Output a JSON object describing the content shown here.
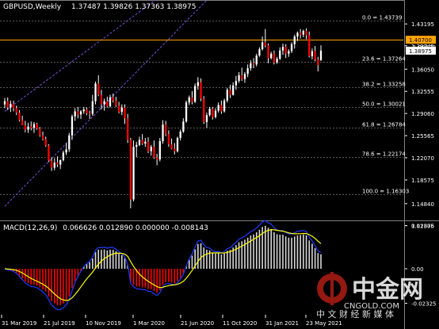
{
  "header": {
    "symbol": "GBPUSD,Weekly",
    "ohlc": "1.37487 1.39826 1.37363 1.38975",
    "macd_title": "MACD(12,26,9)",
    "macd_values": "0.066626 0.012890 0.000000 -0.008143"
  },
  "colors": {
    "bull": "#ffffff",
    "bear": "#ff0000",
    "wick": "#ffffff",
    "grid": "#5a5a5a",
    "axis_text": "#ffffff",
    "resistance": "#ffa500",
    "channel": "#7b4fd6",
    "macd_hist_pos": "#d8d8d8",
    "macd_hist_neg": "#ff0000",
    "macd_line": "#1e3cff",
    "signal_line": "#ffff00",
    "price_box": "#ffffff",
    "resistance_box": "#ffa500"
  },
  "chart_data": [
    {
      "type": "candlestick",
      "title": "GBPUSD,Weekly",
      "timeframe": "Weekly",
      "ylim": [
        1.1319,
        1.4522
      ],
      "y_ticks": [
        1.43195,
        1.39745,
        1.3605,
        1.32555,
        1.2906,
        1.25565,
        1.2207,
        1.18575,
        1.1484,
        1.11375
      ],
      "x_tick_labels": [
        "31 Mar 2019",
        "21 Jul 2019",
        "10 Nov 2019",
        "1 Mar 2020",
        "21 Jun 2020",
        "11 Oct 2020",
        "31 Jan 2021",
        "23 May 2021"
      ],
      "fibonacci": [
        {
          "label": "0.0 = 1.43739",
          "value": 1.43739
        },
        {
          "label": "23.6 = 1.37264",
          "value": 1.37264
        },
        {
          "label": "38.2 = 1.33258",
          "value": 1.33258
        },
        {
          "label": "50.0 = 1.30021",
          "value": 1.30021
        },
        {
          "label": "61.8 = 1.26784",
          "value": 1.26784
        },
        {
          "label": "78.6 = 1.22174",
          "value": 1.22174
        },
        {
          "label": "100.0 = 1.16303",
          "value": 1.16303
        }
      ],
      "resistance": {
        "label": "1.40700",
        "value": 1.407
      },
      "current_price": {
        "label": "1.38975",
        "value": 1.38975
      },
      "hidden_price_label": "1.39620",
      "channel": {
        "upper": [
          [
            0,
            1.294
          ],
          [
            45,
            1.453
          ]
        ],
        "lower": [
          [
            0,
            1.144
          ],
          [
            50,
            1.421
          ]
        ]
      },
      "candles": [
        [
          1.305,
          1.315,
          1.299,
          1.31
        ],
        [
          1.31,
          1.316,
          1.296,
          1.3
        ],
        [
          1.3,
          1.311,
          1.293,
          1.306
        ],
        [
          1.306,
          1.311,
          1.294,
          1.299
        ],
        [
          1.299,
          1.303,
          1.288,
          1.292
        ],
        [
          1.292,
          1.296,
          1.278,
          1.28
        ],
        [
          1.28,
          1.287,
          1.273,
          1.272
        ],
        [
          1.272,
          1.279,
          1.261,
          1.265
        ],
        [
          1.265,
          1.276,
          1.26,
          1.27
        ],
        [
          1.27,
          1.278,
          1.264,
          1.268
        ],
        [
          1.268,
          1.277,
          1.26,
          1.274
        ],
        [
          1.274,
          1.276,
          1.265,
          1.267
        ],
        [
          1.267,
          1.269,
          1.254,
          1.256
        ],
        [
          1.256,
          1.262,
          1.248,
          1.25
        ],
        [
          1.25,
          1.254,
          1.238,
          1.24
        ],
        [
          1.24,
          1.242,
          1.214,
          1.216
        ],
        [
          1.216,
          1.221,
          1.2,
          1.205
        ],
        [
          1.205,
          1.22,
          1.201,
          1.213
        ],
        [
          1.213,
          1.223,
          1.206,
          1.21
        ],
        [
          1.21,
          1.218,
          1.203,
          1.217
        ],
        [
          1.217,
          1.232,
          1.215,
          1.229
        ],
        [
          1.229,
          1.244,
          1.225,
          1.234
        ],
        [
          1.234,
          1.26,
          1.23,
          1.256
        ],
        [
          1.256,
          1.289,
          1.249,
          1.286
        ],
        [
          1.286,
          1.299,
          1.279,
          1.294
        ],
        [
          1.294,
          1.301,
          1.283,
          1.289
        ],
        [
          1.289,
          1.296,
          1.282,
          1.294
        ],
        [
          1.294,
          1.301,
          1.29,
          1.297
        ],
        [
          1.297,
          1.3,
          1.288,
          1.291
        ],
        [
          1.291,
          1.295,
          1.282,
          1.29
        ],
        [
          1.29,
          1.32,
          1.287,
          1.31
        ],
        [
          1.31,
          1.341,
          1.305,
          1.338
        ],
        [
          1.338,
          1.351,
          1.318,
          1.32
        ],
        [
          1.32,
          1.328,
          1.297,
          1.305
        ],
        [
          1.305,
          1.314,
          1.295,
          1.31
        ],
        [
          1.31,
          1.317,
          1.3,
          1.302
        ],
        [
          1.302,
          1.32,
          1.3,
          1.316
        ],
        [
          1.316,
          1.322,
          1.308,
          1.311
        ],
        [
          1.311,
          1.317,
          1.301,
          1.303
        ],
        [
          1.303,
          1.309,
          1.291,
          1.293
        ],
        [
          1.293,
          1.305,
          1.288,
          1.3
        ],
        [
          1.3,
          1.305,
          1.274,
          1.283
        ],
        [
          1.283,
          1.29,
          1.244,
          1.249
        ],
        [
          1.249,
          1.252,
          1.141,
          1.155
        ],
        [
          1.155,
          1.248,
          1.152,
          1.238
        ],
        [
          1.238,
          1.246,
          1.222,
          1.241
        ],
        [
          1.241,
          1.254,
          1.239,
          1.249
        ],
        [
          1.249,
          1.258,
          1.241,
          1.243
        ],
        [
          1.243,
          1.252,
          1.238,
          1.246
        ],
        [
          1.246,
          1.253,
          1.228,
          1.231
        ],
        [
          1.231,
          1.241,
          1.224,
          1.238
        ],
        [
          1.238,
          1.248,
          1.219,
          1.221
        ],
        [
          1.221,
          1.227,
          1.209,
          1.218
        ],
        [
          1.218,
          1.252,
          1.215,
          1.247
        ],
        [
          1.247,
          1.28,
          1.243,
          1.273
        ],
        [
          1.273,
          1.279,
          1.255,
          1.258
        ],
        [
          1.258,
          1.264,
          1.238,
          1.242
        ],
        [
          1.242,
          1.251,
          1.234,
          1.235
        ],
        [
          1.235,
          1.244,
          1.226,
          1.231
        ],
        [
          1.231,
          1.254,
          1.229,
          1.252
        ],
        [
          1.252,
          1.265,
          1.248,
          1.262
        ],
        [
          1.262,
          1.283,
          1.26,
          1.278
        ],
        [
          1.278,
          1.311,
          1.276,
          1.308
        ],
        [
          1.308,
          1.319,
          1.304,
          1.316
        ],
        [
          1.316,
          1.326,
          1.305,
          1.309
        ],
        [
          1.309,
          1.338,
          1.307,
          1.334
        ],
        [
          1.334,
          1.348,
          1.328,
          1.34
        ],
        [
          1.34,
          1.346,
          1.31,
          1.314
        ],
        [
          1.314,
          1.318,
          1.274,
          1.277
        ],
        [
          1.277,
          1.292,
          1.268,
          1.288
        ],
        [
          1.288,
          1.301,
          1.286,
          1.298
        ],
        [
          1.298,
          1.301,
          1.281,
          1.285
        ],
        [
          1.285,
          1.299,
          1.283,
          1.295
        ],
        [
          1.295,
          1.308,
          1.292,
          1.304
        ],
        [
          1.304,
          1.311,
          1.29,
          1.294
        ],
        [
          1.294,
          1.314,
          1.292,
          1.311
        ],
        [
          1.311,
          1.331,
          1.308,
          1.328
        ],
        [
          1.328,
          1.336,
          1.315,
          1.32
        ],
        [
          1.32,
          1.34,
          1.319,
          1.335
        ],
        [
          1.335,
          1.35,
          1.328,
          1.342
        ],
        [
          1.342,
          1.356,
          1.339,
          1.351
        ],
        [
          1.351,
          1.363,
          1.342,
          1.345
        ],
        [
          1.345,
          1.356,
          1.339,
          1.353
        ],
        [
          1.353,
          1.368,
          1.348,
          1.362
        ],
        [
          1.362,
          1.375,
          1.358,
          1.37
        ],
        [
          1.37,
          1.378,
          1.362,
          1.368
        ],
        [
          1.368,
          1.385,
          1.365,
          1.382
        ],
        [
          1.382,
          1.395,
          1.38,
          1.392
        ],
        [
          1.392,
          1.412,
          1.39,
          1.403
        ],
        [
          1.403,
          1.424,
          1.395,
          1.398
        ],
        [
          1.398,
          1.401,
          1.37,
          1.378
        ],
        [
          1.378,
          1.388,
          1.376,
          1.385
        ],
        [
          1.385,
          1.39,
          1.368,
          1.371
        ],
        [
          1.371,
          1.38,
          1.369,
          1.377
        ],
        [
          1.377,
          1.395,
          1.375,
          1.39
        ],
        [
          1.39,
          1.401,
          1.383,
          1.396
        ],
        [
          1.396,
          1.4,
          1.378,
          1.385
        ],
        [
          1.385,
          1.392,
          1.38,
          1.389
        ],
        [
          1.389,
          1.403,
          1.386,
          1.4
        ],
        [
          1.4,
          1.415,
          1.393,
          1.412
        ],
        [
          1.412,
          1.42,
          1.405,
          1.418
        ],
        [
          1.418,
          1.424,
          1.409,
          1.415
        ],
        [
          1.415,
          1.423,
          1.411,
          1.421
        ],
        [
          1.421,
          1.425,
          1.408,
          1.414
        ],
        [
          1.414,
          1.42,
          1.379,
          1.381
        ],
        [
          1.381,
          1.393,
          1.376,
          1.389
        ],
        [
          1.389,
          1.397,
          1.373,
          1.376
        ],
        [
          1.376,
          1.38,
          1.357,
          1.367
        ],
        [
          1.3749,
          1.3983,
          1.3736,
          1.3898
        ]
      ]
    },
    {
      "type": "histogram",
      "title": "MACD(12,26,9)",
      "values_text": "0.066626 0.012890 0.000000 -0.008143",
      "ylim": [
        -0.03,
        0.03
      ],
      "y_tick_labels": [
        "0.02806",
        "0.00",
        "-0.02325"
      ],
      "series": [
        {
          "name": "Main",
          "type": "bar"
        },
        {
          "name": "Signal",
          "type": "line",
          "color": "#ffff00"
        },
        {
          "name": "MACD line",
          "type": "line",
          "color": "#1e3cff"
        }
      ]
    }
  ],
  "watermark": {
    "brand": "中金网",
    "domain": "CNGOLD.COM",
    "tagline": "中 文 财 经 新 媒 体"
  }
}
